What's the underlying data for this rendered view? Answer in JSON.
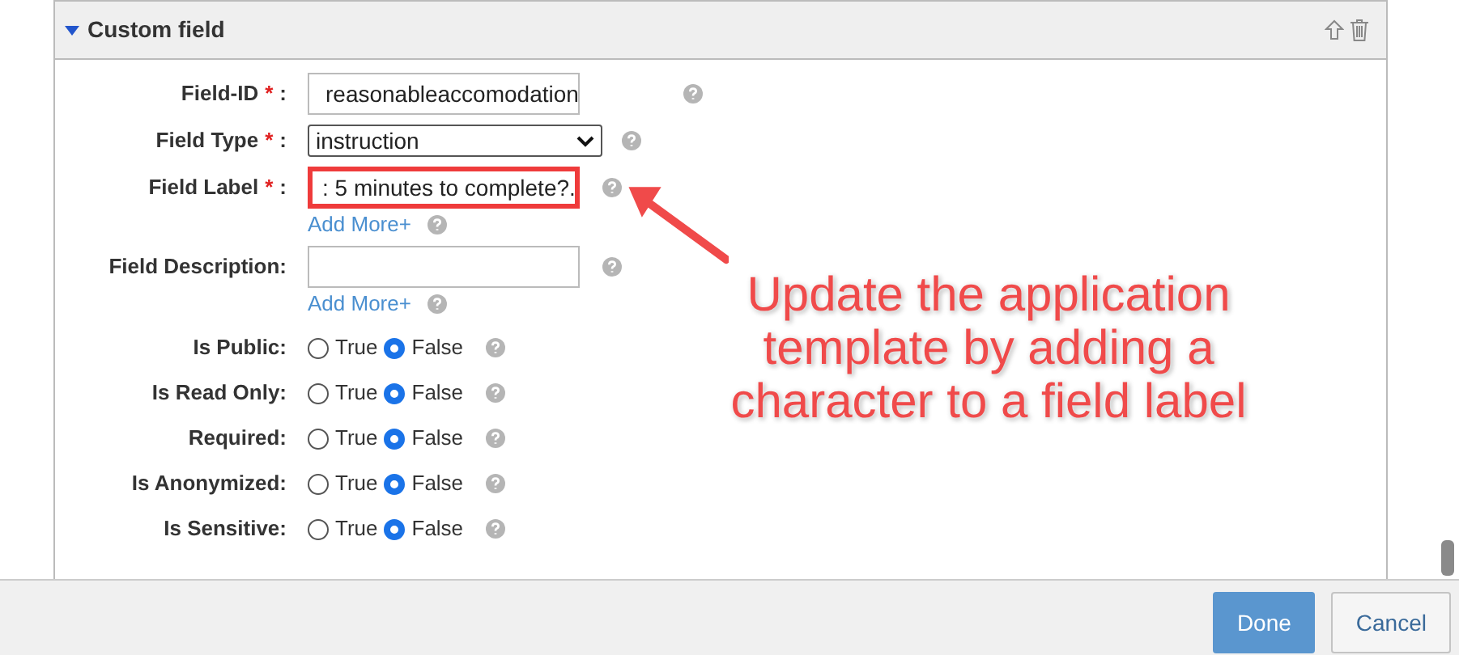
{
  "panel": {
    "title": "Custom field",
    "expanded": true
  },
  "fields": [
    {
      "kind": "text",
      "label": "Field-ID",
      "required_mark": "*",
      "suffix": ":",
      "value": "reasonableaccomodation"
    },
    {
      "kind": "select",
      "label": "Field Type",
      "required_mark": "*",
      "suffix": ":",
      "value": "instruction"
    },
    {
      "kind": "text",
      "label": "Field Label",
      "required_mark": "*",
      "suffix": ":",
      "value": ": 5 minutes to complete?.",
      "highlighted": true,
      "add_more": "Add More+"
    },
    {
      "kind": "text",
      "label": "Field Description:",
      "add_more": "Add More+"
    },
    {
      "kind": "radio",
      "label": "Is Public:",
      "options": [
        {
          "label": "True",
          "selected": false
        },
        {
          "label": "False",
          "selected": true
        }
      ]
    },
    {
      "kind": "radio",
      "label": "Is Read Only:",
      "options": [
        {
          "label": "True",
          "selected": false
        },
        {
          "label": "False",
          "selected": true
        }
      ]
    },
    {
      "kind": "radio",
      "label": "Required:",
      "options": [
        {
          "label": "True",
          "selected": false
        },
        {
          "label": "False",
          "selected": true
        }
      ]
    },
    {
      "kind": "radio",
      "label": "Is Anonymized:",
      "options": [
        {
          "label": "True",
          "selected": false
        },
        {
          "label": "False",
          "selected": true
        }
      ]
    },
    {
      "kind": "radio",
      "label": "Is Sensitive:",
      "options": [
        {
          "label": "True",
          "selected": false
        },
        {
          "label": "False",
          "selected": true
        }
      ]
    }
  ],
  "annotation": {
    "text": "Update the application template by adding a character to a field label"
  },
  "buttons": [
    {
      "label": "Done",
      "kind": "primary"
    },
    {
      "label": "Cancel",
      "kind": "secondary"
    }
  ]
}
